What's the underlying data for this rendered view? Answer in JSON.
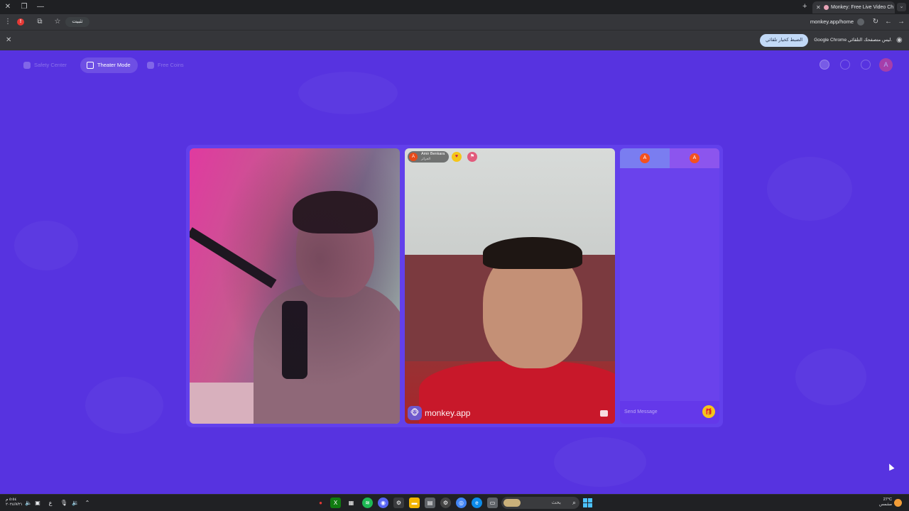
{
  "browser": {
    "tab_title": "Monkey: Free Live Video Ch",
    "url": "monkey.app/home",
    "install_label": "تثبيت",
    "infobar_text": "Google Chrome ليس متصفحك التلقائي.",
    "infobar_button": "الضبط كخيار تلقائي"
  },
  "page": {
    "nav": {
      "safety": "Safety Center",
      "theater": "Theater Mode",
      "free_coins": "Free Coins"
    },
    "profile_initial": "A",
    "remote_user": {
      "initial": "A",
      "name": "Amir Benkara",
      "country": "الجزائر"
    },
    "watermark": "monkey.app",
    "chat": {
      "tab1_initial": "A",
      "tab2_initial": "A",
      "placeholder": "Send Message"
    }
  },
  "taskbar": {
    "time": "٥:٥٤ م",
    "date": "٢٠٢٤/٧/٢١",
    "lang": "ع",
    "search_label": "بحث",
    "weather_temp": "27°C",
    "weather_desc": "مشمس"
  },
  "colors": {
    "page_bg": "#5733e0",
    "accent_yellow": "#f5c518",
    "avatar_orange": "#e64a19"
  }
}
